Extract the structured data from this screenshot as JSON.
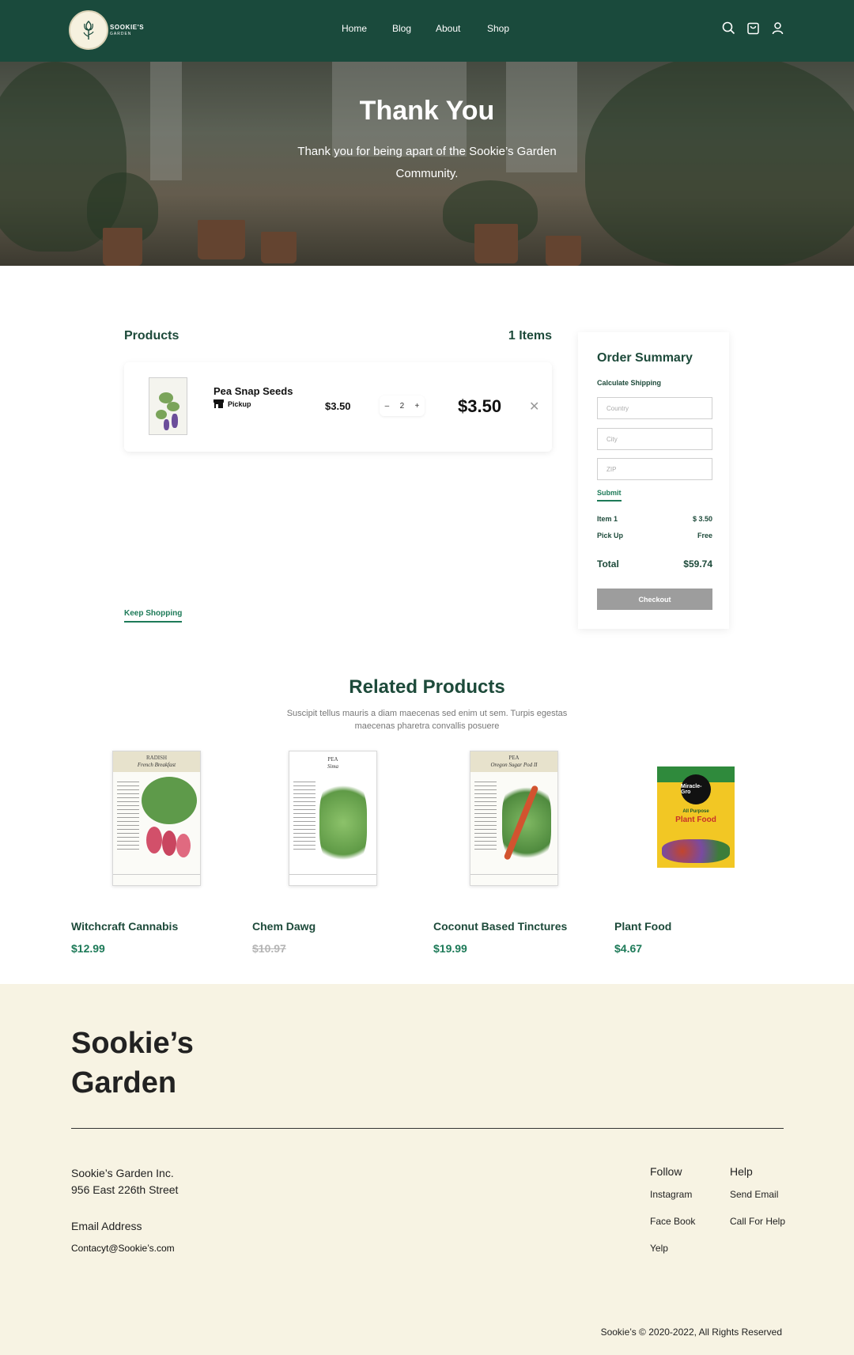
{
  "brand": {
    "logo_line1": "SOOKIE'S",
    "logo_line2": "GARDEN"
  },
  "nav": {
    "items": [
      "Home",
      "Blog",
      "About",
      "Shop"
    ]
  },
  "header_icons": [
    "search-icon",
    "cart-icon",
    "user-icon"
  ],
  "hero": {
    "title": "Thank You",
    "subtitle": "Thank you for being apart of the Sookie’s Garden Community."
  },
  "cart": {
    "products_label": "Products",
    "items_count_label": "1 Items",
    "item": {
      "name": "Pea Snap Seeds",
      "method": "Pickup",
      "price": "$3.50",
      "quantity": "2",
      "minus": "–",
      "plus": "+",
      "total": "$3.50",
      "remove": "✕"
    },
    "keep_shopping": "Keep Shopping"
  },
  "summary": {
    "title": "Order Summary",
    "calc_label": "Calculate Shipping",
    "country_placeholder": "Country",
    "city_placeholder": "City",
    "zip_placeholder": "ZIP",
    "submit": "Submit",
    "item_label": "Item  1",
    "item_value": "$ 3.50",
    "pickup_label": "Pick Up",
    "pickup_value": "Free",
    "total_label": "Total",
    "total_value": "$59.74",
    "checkout": "Checkout"
  },
  "related": {
    "title": "Related Products",
    "subtitle": "Suscipit tellus mauris a diam maecenas sed enim ut sem. Turpis egestas maecenas pharetra convallis posuere",
    "products": [
      {
        "name": "Witchcraft Cannabis",
        "price": "$12.99",
        "strikethrough": false,
        "packet_title": "RADISH",
        "packet_variety": "French Breakfast"
      },
      {
        "name": "Chem Dawg",
        "price": "$10.97",
        "strikethrough": true,
        "packet_title": "PEA",
        "packet_variety": "Sima"
      },
      {
        "name": "Coconut Based Tinctures",
        "price": "$19.99",
        "strikethrough": false,
        "packet_title": "PEA",
        "packet_variety": "Oregon Sugar Pod II"
      },
      {
        "name": "Plant Food",
        "price": "$4.67",
        "strikethrough": false,
        "box_brand": "Miracle-Gro",
        "box_label1": "All Purpose",
        "box_label2": "Plant Food"
      }
    ]
  },
  "footer": {
    "brand_line1": "Sookie’s",
    "brand_line2": "Garden",
    "company": "Sookie’s Garden Inc.",
    "street": "956 East 226th Street",
    "email_heading": "Email Address",
    "email": "Contacyt@Sookie’s.com",
    "follow_heading": "Follow",
    "follow_links": [
      "Instagram",
      "Face Book",
      "Yelp"
    ],
    "help_heading": "Help",
    "help_links": [
      "Send Email",
      "Call For Help"
    ],
    "copyright": "Sookie’s © 2020-2022, All Rights Reserved"
  },
  "colors": {
    "header": "#1a4a3c",
    "accent": "#1d7a58",
    "heading": "#1d4a3a",
    "footer_bg": "#f7f3e3",
    "checkout_btn": "#9d9d9d"
  }
}
